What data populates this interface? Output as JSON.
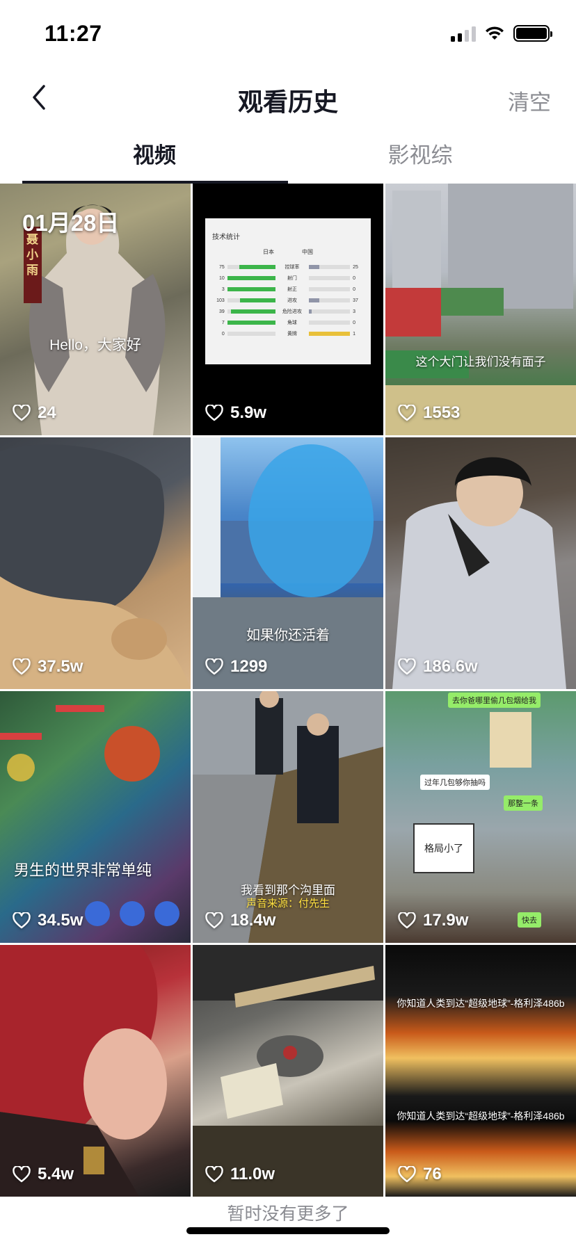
{
  "status_bar": {
    "time": "11:27"
  },
  "nav": {
    "title": "观看历史",
    "clear_label": "清空"
  },
  "tabs": [
    {
      "label": "视频",
      "active": true
    },
    {
      "label": "影视综",
      "active": false
    }
  ],
  "date_label": "01月28日",
  "videos": [
    {
      "likes": "24",
      "caption": "Hello，大家好"
    },
    {
      "likes": "5.9w",
      "caption": ""
    },
    {
      "likes": "1553",
      "caption": "这个大门让我们没有面子"
    },
    {
      "likes": "37.5w",
      "caption": ""
    },
    {
      "likes": "1299",
      "caption": "如果你还活着"
    },
    {
      "likes": "186.6w",
      "caption": ""
    },
    {
      "likes": "34.5w",
      "caption": "男生的世界非常单纯"
    },
    {
      "likes": "18.4w",
      "caption": "我看到那个沟里面"
    },
    {
      "likes": "17.9w",
      "caption": ""
    },
    {
      "likes": "5.4w",
      "caption": ""
    },
    {
      "likes": "11.0w",
      "caption": ""
    },
    {
      "likes": "76",
      "caption": "你知道人类到达“超级地球”-格利泽486b"
    }
  ],
  "thumb_text": {
    "v1_side": "聂小雨",
    "v8_sub": "声音来源：付先生",
    "v9_top": "去你爸哪里偷几包烟给我",
    "v9_msg1": "过年几包够你抽吗",
    "v9_msg2": "那整一条",
    "v9_msg3": "快去",
    "v9_note": "格局小了",
    "v12_second": "你知道人类到达“超级地球”-格利泽486b"
  },
  "stats_panel": {
    "title": "技术统计",
    "team_left": "日本",
    "team_right": "中国",
    "rows": [
      {
        "left": "75",
        "name": "控球率",
        "right": "25",
        "lfrac": 0.75,
        "rfrac": 0.25
      },
      {
        "left": "10",
        "name": "射门",
        "right": "0",
        "lfrac": 1.0,
        "rfrac": 0.0
      },
      {
        "left": "3",
        "name": "射正",
        "right": "0",
        "lfrac": 1.0,
        "rfrac": 0.0
      },
      {
        "left": "103",
        "name": "进攻",
        "right": "37",
        "lfrac": 0.74,
        "rfrac": 0.26
      },
      {
        "left": "39",
        "name": "危险进攻",
        "right": "3",
        "lfrac": 0.93,
        "rfrac": 0.07
      },
      {
        "left": "7",
        "name": "角球",
        "right": "0",
        "lfrac": 1.0,
        "rfrac": 0.0
      },
      {
        "left": "0",
        "name": "黄牌",
        "right": "1",
        "lfrac": 0.0,
        "rfrac": 1.0
      }
    ]
  },
  "footer": {
    "no_more": "暂时没有更多了"
  },
  "colors": {
    "text_primary": "#161823",
    "text_secondary": "#8a8b91",
    "accent_green": "#3cb54a"
  }
}
